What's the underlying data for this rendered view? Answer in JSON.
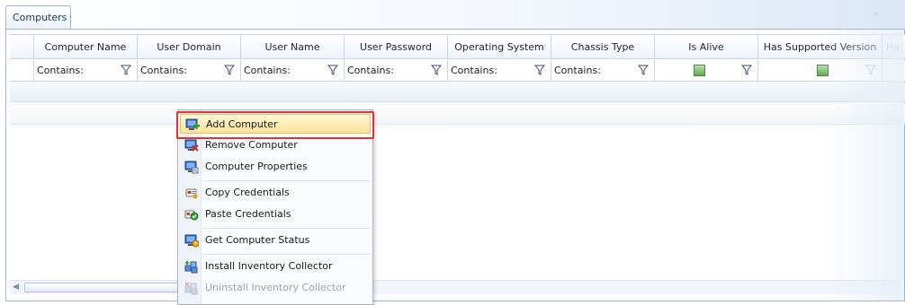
{
  "tab": {
    "label": "Computers"
  },
  "grid": {
    "columns": [
      {
        "label": "Computer Name",
        "filter": "Contains:"
      },
      {
        "label": "User Domain",
        "filter": "Contains:"
      },
      {
        "label": "User Name",
        "filter": "Contains:"
      },
      {
        "label": "User Password",
        "filter": "Contains:"
      },
      {
        "label": "Operating System",
        "filter": "Contains:"
      },
      {
        "label": "Chassis Type",
        "filter": "Contains:"
      },
      {
        "label": "Is Alive",
        "filter": ""
      },
      {
        "label": "Has Supported Version",
        "filter": ""
      },
      {
        "label": "Ha",
        "filter": ""
      }
    ]
  },
  "context_menu": {
    "items": [
      {
        "label": "Add Computer",
        "icon": "add-computer-icon",
        "state": "highlighted"
      },
      {
        "label": "Remove Computer",
        "icon": "remove-computer-icon",
        "state": "enabled"
      },
      {
        "label": "Computer Properties",
        "icon": "computer-properties-icon",
        "state": "enabled"
      },
      {
        "label": "Copy Credentials",
        "icon": "copy-credentials-icon",
        "state": "enabled"
      },
      {
        "label": "Paste Credentials",
        "icon": "paste-credentials-icon",
        "state": "enabled"
      },
      {
        "label": "Get Computer Status",
        "icon": "computer-status-icon",
        "state": "enabled"
      },
      {
        "label": "Install Inventory Collector",
        "icon": "install-collector-icon",
        "state": "enabled"
      },
      {
        "label": "Uninstall Inventory Collector",
        "icon": "uninstall-collector-icon",
        "state": "disabled"
      }
    ]
  },
  "colors": {
    "accent_border": "#9eb6d4",
    "highlight": "#ffe49a",
    "callout": "#e03434"
  }
}
